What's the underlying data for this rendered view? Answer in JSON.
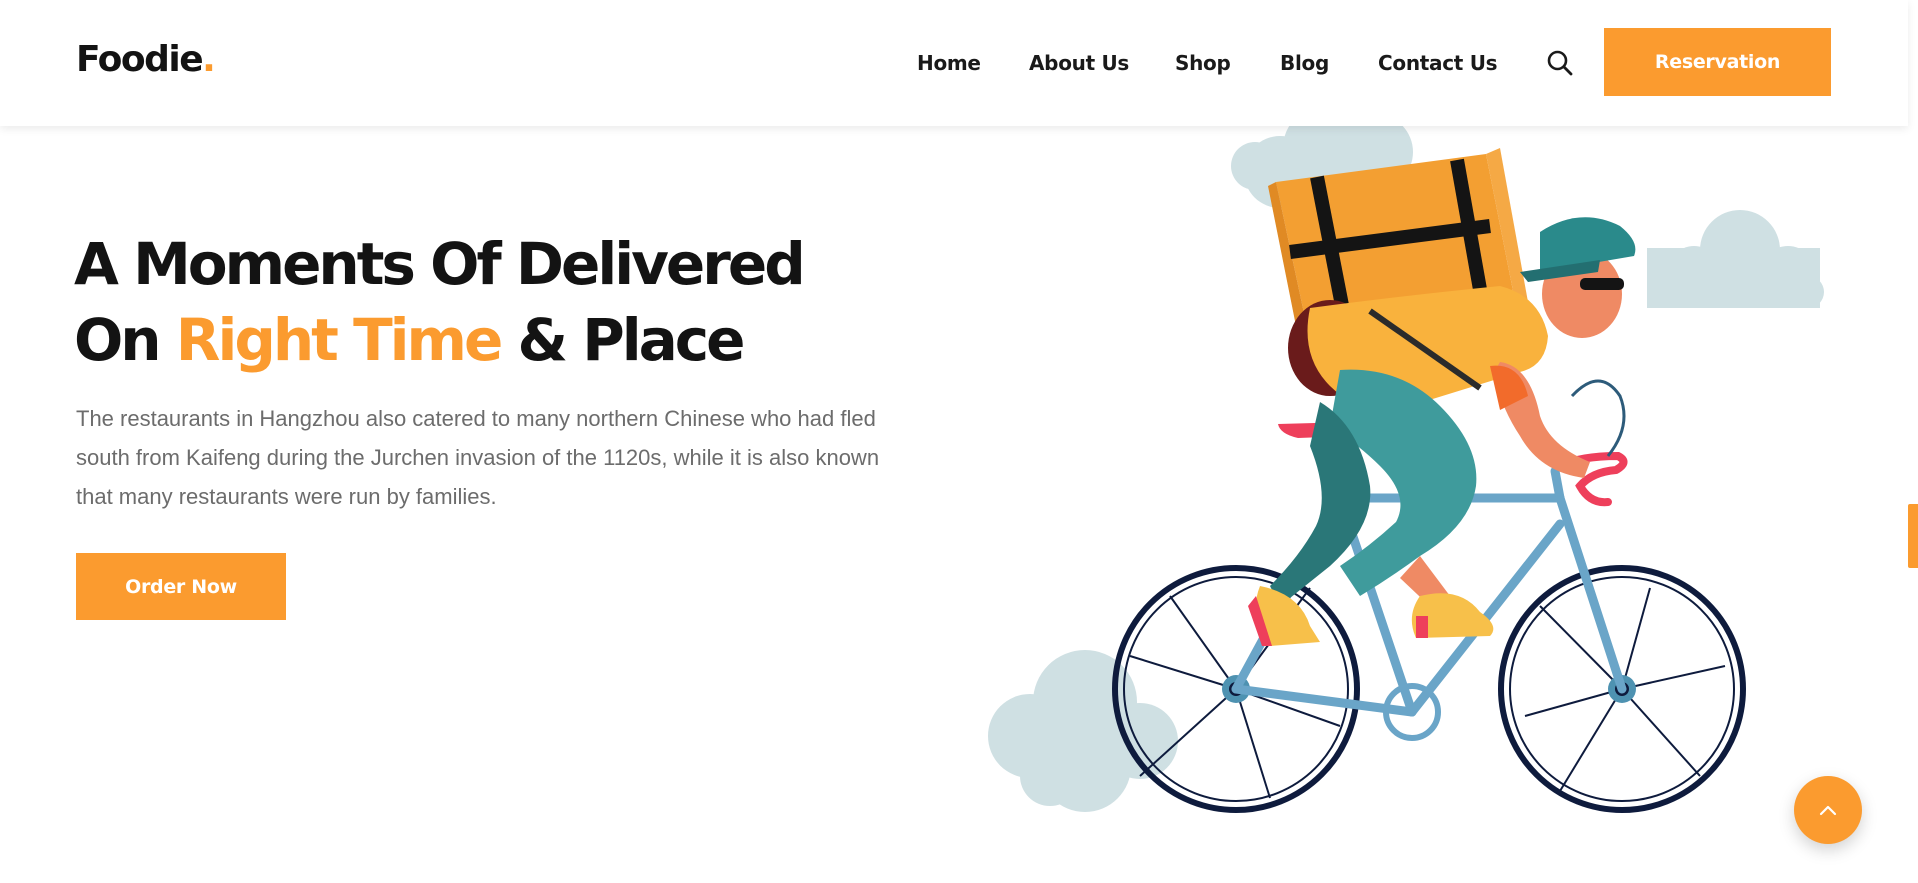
{
  "brand": {
    "name": "Foodie",
    "dot": ".",
    "accent_color": "#fb9b2f"
  },
  "nav": {
    "items": [
      {
        "label": "Home"
      },
      {
        "label": "About Us"
      },
      {
        "label": "Shop"
      },
      {
        "label": "Blog"
      },
      {
        "label": "Contact Us"
      }
    ],
    "search_icon": "search-icon",
    "reservation_label": "Reservation"
  },
  "hero": {
    "title_line1": "A Moments Of Delivered",
    "title_line2_pre": "On ",
    "title_line2_accent": "Right Time",
    "title_line2_post": " & Place",
    "description": "The restaurants in Hangzhou also catered to many northern Chinese who had fled south from Kaifeng during the Jurchen invasion of the 1120s, while it is also known that many restaurants were run by families.",
    "button_label": "Order Now"
  },
  "illustration": {
    "subject": "delivery-courier-on-bicycle"
  },
  "scroll_top_icon": "chevron-up-icon",
  "colors": {
    "primary": "#fb9b2f",
    "heading": "#131313",
    "body_text": "#6c6c6c",
    "cloud": "#cfe0e3"
  }
}
